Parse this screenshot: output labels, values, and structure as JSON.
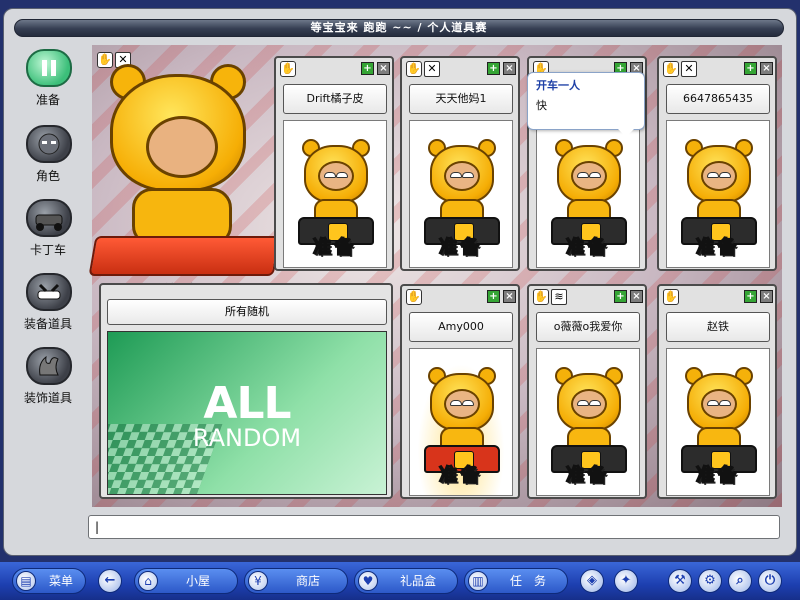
{
  "window": {
    "title": "等宝宝来 跑跑 ~~ / 个人道具赛"
  },
  "sidebar": {
    "items": [
      {
        "label": "准备",
        "icon": "pause-icon"
      },
      {
        "label": "角色",
        "icon": "character-icon"
      },
      {
        "label": "卡丁车",
        "icon": "kart-icon"
      },
      {
        "label": "装备道具",
        "icon": "equipment-icon"
      },
      {
        "label": "装饰道具",
        "icon": "decoration-icon"
      }
    ]
  },
  "self": {
    "status": "准备"
  },
  "players": [
    {
      "name": "Drift橘子皮",
      "status": "准备"
    },
    {
      "name": "天天他妈1",
      "status": "准备"
    },
    {
      "name": "",
      "status": "准备"
    },
    {
      "name": "6647865435",
      "status": "准备"
    },
    {
      "name": "Amy000",
      "status": "准备"
    },
    {
      "name": "o薇薇o我爱你",
      "status": "准备"
    },
    {
      "name": "赵铁",
      "status": "准备"
    }
  ],
  "chat_bubble": {
    "title": "开车一人",
    "text": "快"
  },
  "map": {
    "name": "所有随机",
    "line1": "ALL",
    "line2": "RANDOM"
  },
  "chat": {
    "value": "|"
  },
  "taskbar": {
    "menu": "菜单",
    "house": "小屋",
    "shop": "商店",
    "gift": "礼品盒",
    "mission": "任　务"
  },
  "colors": {
    "accent": "#1d3fb0",
    "character": "#f6ae05",
    "plus_button": "#35a535"
  }
}
